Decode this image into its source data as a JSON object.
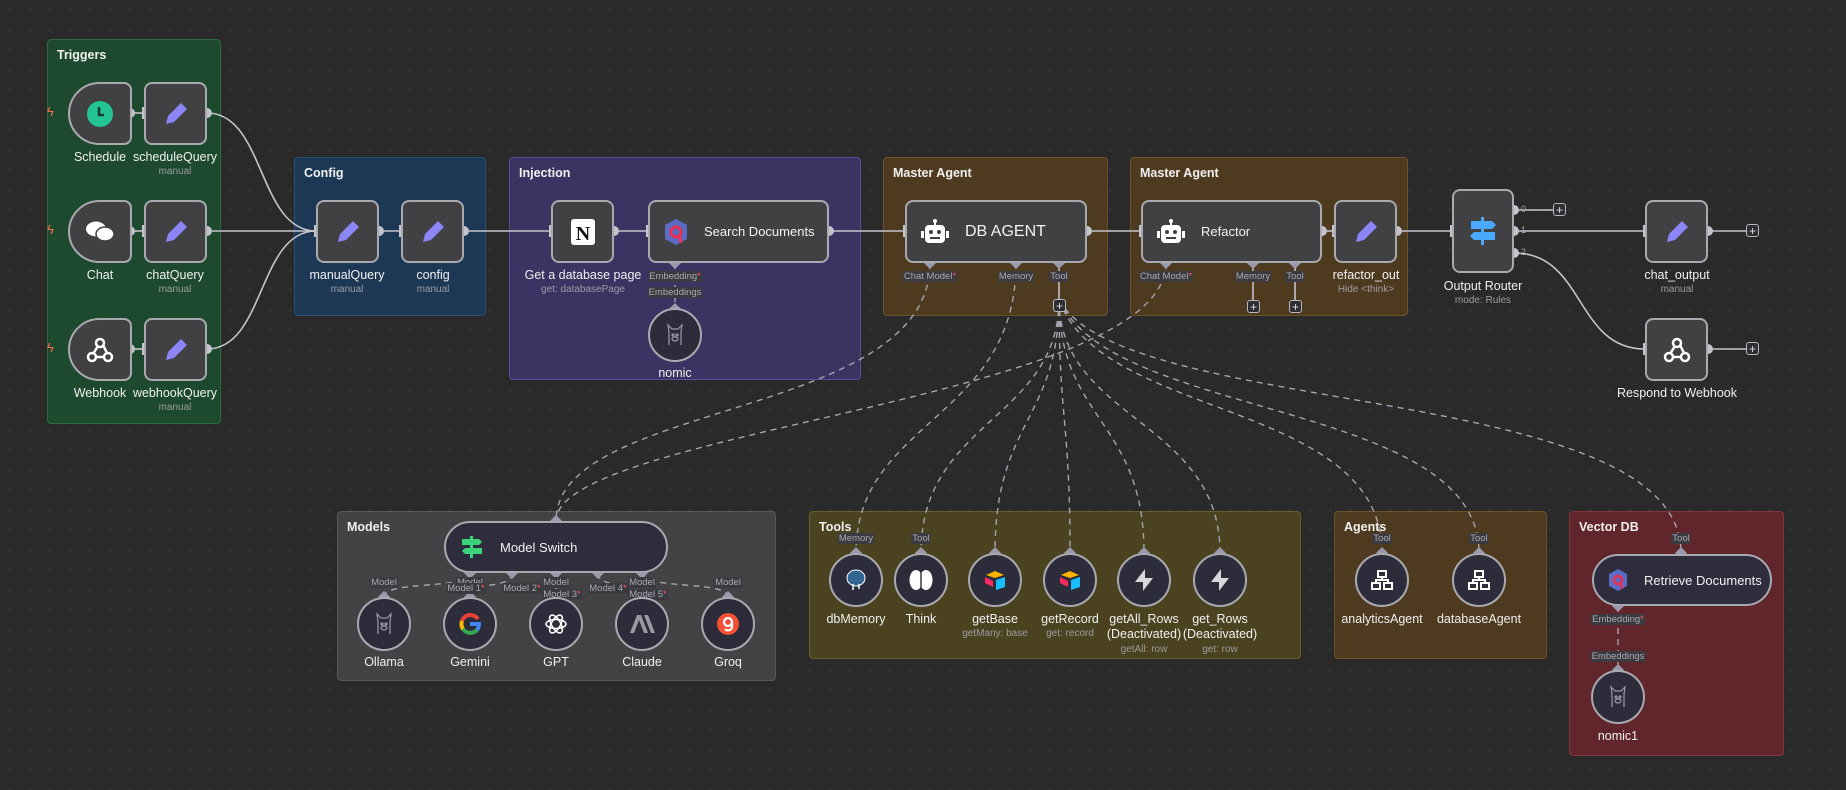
{
  "groups": {
    "triggers": "Triggers",
    "config": "Config",
    "injection": "Injection",
    "master_agent_1": "Master Agent",
    "master_agent_2": "Master Agent",
    "models": "Models",
    "tools": "Tools",
    "agents": "Agents",
    "vector_db": "Vector DB"
  },
  "colors": {
    "triggers": "#1d4a2e",
    "config": "#1c3855",
    "injection": "#3a3462",
    "master_agent": "#4e3b1f",
    "models": "#434345",
    "tools": "#4b4220",
    "vector_db": "#61262b",
    "pencil_accent": "#8b85f5",
    "trigger_bolt": "#ff6b4a"
  },
  "nodes": {
    "schedule": {
      "label": "Schedule",
      "icon": "clock-icon"
    },
    "scheduleQuery": {
      "label": "scheduleQuery",
      "sub": "manual",
      "icon": "pencil-icon"
    },
    "chat": {
      "label": "Chat",
      "icon": "chat-bubbles-icon"
    },
    "chatQuery": {
      "label": "chatQuery",
      "sub": "manual",
      "icon": "pencil-icon"
    },
    "webhook": {
      "label": "Webhook",
      "icon": "webhook-icon"
    },
    "webhookQuery": {
      "label": "webhookQuery",
      "sub": "manual",
      "icon": "pencil-icon"
    },
    "manualQuery": {
      "label": "manualQuery",
      "sub": "manual"
    },
    "config": {
      "label": "config",
      "sub": "manual"
    },
    "notion": {
      "label": "Get a database page",
      "sub": "get: databasePage",
      "icon": "notion-icon"
    },
    "searchDocs": {
      "label": "Search Documents",
      "icon": "qdrant-icon",
      "handle_embedding": "Embedding"
    },
    "nomic": {
      "label": "nomic",
      "handle": "Embeddings",
      "icon": "ollama-icon"
    },
    "dbAgent": {
      "label": "DB AGENT",
      "handles": [
        "Chat Model",
        "Memory",
        "Tool"
      ]
    },
    "refactor": {
      "label": "Refactor",
      "handles": [
        "Chat Model",
        "Memory",
        "Tool"
      ]
    },
    "refactor_out": {
      "label": "refactor_out",
      "sub": "Hide <think>"
    },
    "router": {
      "label": "Output Router",
      "sub": "mode: Rules",
      "outputs": [
        "0",
        "1",
        "2"
      ]
    },
    "chat_output": {
      "label": "chat_output",
      "sub": "manual"
    },
    "respond": {
      "label": "Respond to Webhook"
    },
    "modelSwitch": {
      "label": "Model Switch",
      "inputs": [
        "Model 1",
        "Model 2",
        "Model 3",
        "Model 4",
        "Model 5"
      ]
    },
    "ollama": {
      "label": "Ollama",
      "handle": "Model"
    },
    "gemini": {
      "label": "Gemini",
      "handle": "Model"
    },
    "gpt": {
      "label": "GPT",
      "handle": "Model"
    },
    "claude": {
      "label": "Claude",
      "handle": "Model"
    },
    "groq": {
      "label": "Groq",
      "handle": "Model"
    },
    "dbMemory": {
      "label": "dbMemory",
      "handle": "Memory"
    },
    "think": {
      "label": "Think",
      "handle": "Tool"
    },
    "getBase": {
      "label": "getBase",
      "sub": "getMany: base"
    },
    "getRecord": {
      "label": "getRecord",
      "sub": "get: record"
    },
    "getAllRows": {
      "label": "getAll_Rows",
      "label2": "(Deactivated)",
      "sub": "getAll: row"
    },
    "getRows": {
      "label": "get_Rows",
      "label2": "(Deactivated)",
      "sub": "get: row"
    },
    "analyticsAgent": {
      "label": "analyticsAgent",
      "handle": "Tool"
    },
    "databaseAgent": {
      "label": "databaseAgent",
      "handle": "Tool"
    },
    "retrieveDocs": {
      "label": "Retrieve Documents",
      "handle": "Tool",
      "handle_embedding": "Embedding"
    },
    "nomic1": {
      "label": "nomic1",
      "handle": "Embeddings"
    }
  },
  "plus_label": "+",
  "required_mark": "*"
}
